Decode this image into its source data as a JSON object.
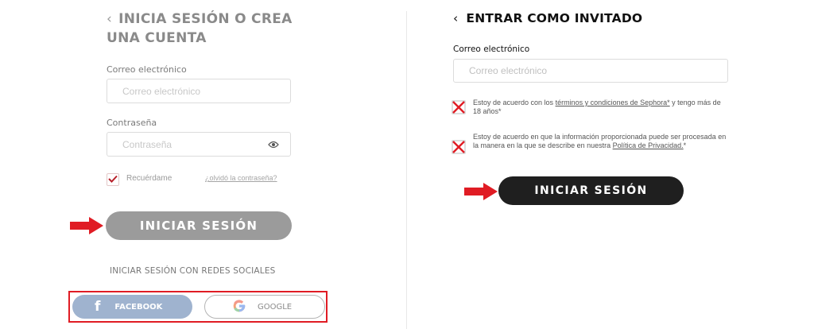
{
  "colors": {
    "annotation_red": "#e01c24",
    "primary_dark": "#1f1f1f",
    "disabled_grey": "#9b9b9b",
    "facebook_faded": "#9fb3cf"
  },
  "left_panel": {
    "back_chevron": "‹",
    "title": "INICIA SESIÓN O CREA UNA CUENTA",
    "email": {
      "label": "Correo electrónico",
      "placeholder": "Correo electrónico"
    },
    "password": {
      "label": "Contraseña",
      "placeholder": "Contraseña",
      "icon": "eye-icon"
    },
    "remember_label": "Recuérdame",
    "remember_checked": true,
    "forgot_link": "¿olvidó la contraseña?",
    "login_button": "INICIAR SESIÓN",
    "social_title": "INICIAR SESIÓN CON REDES SOCIALES",
    "facebook": {
      "icon": "facebook-icon",
      "glyph": "f",
      "label": "FACEBOOK"
    },
    "google": {
      "icon": "google-icon",
      "label": "GOOGLE"
    }
  },
  "right_panel": {
    "back_chevron": "‹",
    "title": "ENTRAR COMO INVITADO",
    "email": {
      "label": "Correo electrónico",
      "placeholder": "Correo electrónico"
    },
    "consent_terms": {
      "text_before": "Estoy de acuerdo con los ",
      "link": "términos y condiciones de Sephora*",
      "text_after": " y tengo más de 18 años*",
      "checked": false
    },
    "consent_privacy": {
      "text_before": "Estoy de acuerdo en que la información proporcionada puede ser procesada en la manera en la que se describe en nuestra ",
      "link": "Política de Privacidad.",
      "text_after": "*",
      "checked": false
    },
    "login_button": "INICIAR SESIÓN"
  }
}
